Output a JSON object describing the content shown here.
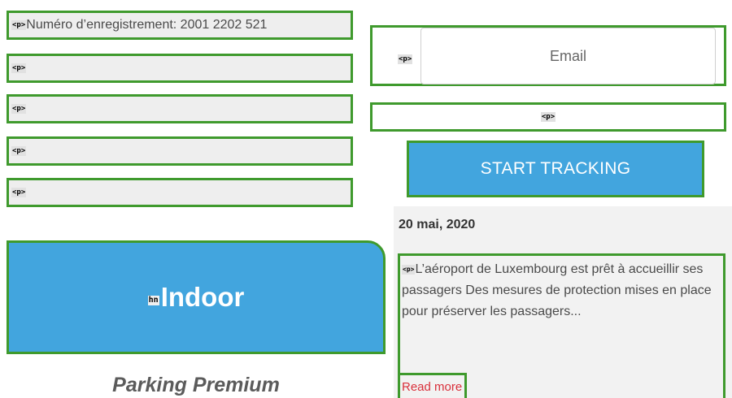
{
  "registration": {
    "lines": [
      {
        "tag": "<p>",
        "text": "Numéro d’enregistrement: 2001 2202 521"
      },
      {
        "tag": "<p>",
        "text": ""
      },
      {
        "tag": "<p>",
        "text": ""
      },
      {
        "tag": "<p>",
        "text": ""
      },
      {
        "tag": "<p>",
        "text": ""
      }
    ]
  },
  "tracking": {
    "email_tag": "<p>",
    "email_placeholder": "Email",
    "email_value": "",
    "status_tag": "<p>",
    "button_label": "START TRACKING"
  },
  "indoor": {
    "tag": "hn",
    "title": "Indoor",
    "subtitle": "Parking Premium"
  },
  "news": {
    "date": "20 mai, 2020",
    "tag": "<p>",
    "excerpt": "L’aéroport de Luxembourg est prêt à accueillir ses passagers Des mesures de protection mises en place pour préserver les passagers...",
    "read_more": "Read more"
  },
  "colors": {
    "accent_blue": "#42a5de",
    "outline_green": "#3f9a2d",
    "link_red": "#d9303b",
    "panel_gray": "#eeeeee"
  }
}
